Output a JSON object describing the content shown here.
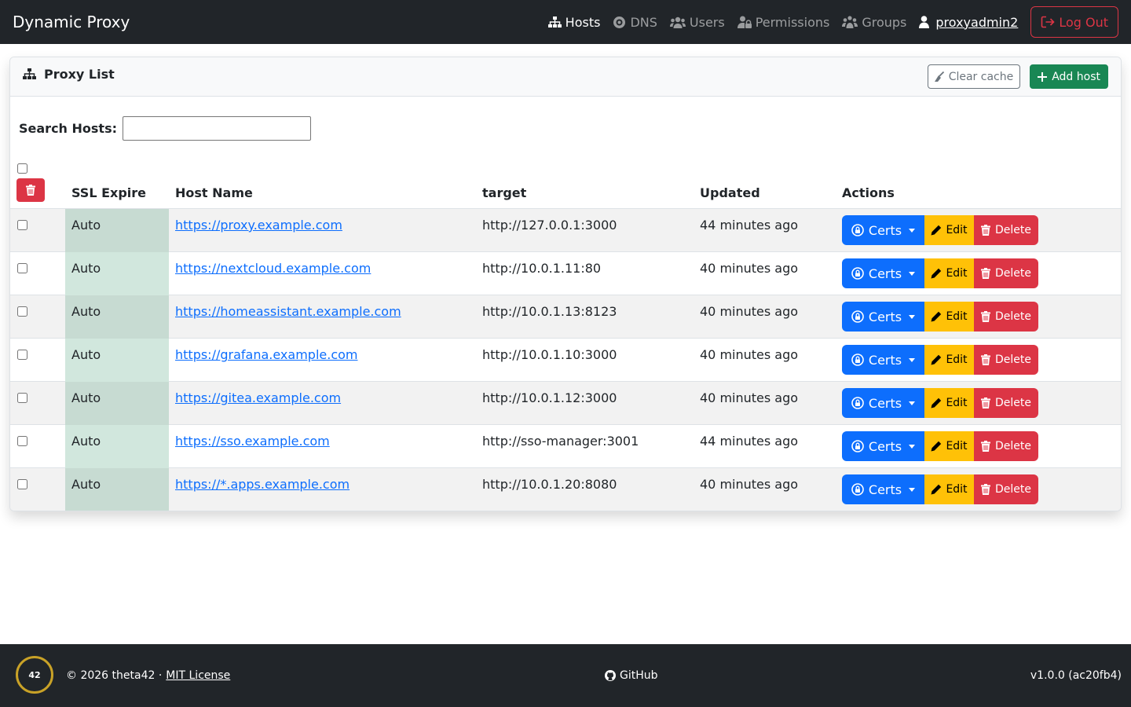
{
  "navbar": {
    "brand": "Dynamic Proxy",
    "links": [
      {
        "label": "Hosts",
        "icon": "sitemap-icon",
        "active": true
      },
      {
        "label": "DNS",
        "icon": "dns-icon",
        "active": false
      },
      {
        "label": "Users",
        "icon": "users-icon",
        "active": false
      },
      {
        "label": "Permissions",
        "icon": "user-lock-icon",
        "active": false
      },
      {
        "label": "Groups",
        "icon": "groups-icon",
        "active": false
      }
    ],
    "username": "proxyadmin2",
    "logout_label": "Log Out"
  },
  "card": {
    "title": "Proxy List",
    "clear_cache_label": "Clear cache",
    "add_host_label": "Add host"
  },
  "search": {
    "label": "Search Hosts:",
    "value": "",
    "placeholder": ""
  },
  "table": {
    "columns": [
      "SSL Expire",
      "Host Name",
      "target",
      "Updated",
      "Actions"
    ],
    "rows": [
      {
        "ssl": "Auto",
        "host": "https://proxy.example.com",
        "target": "http://127.0.0.1:3000",
        "updated": "44 minutes ago"
      },
      {
        "ssl": "Auto",
        "host": "https://nextcloud.example.com",
        "target": "http://10.0.1.11:80",
        "updated": "40 minutes ago"
      },
      {
        "ssl": "Auto",
        "host": "https://homeassistant.example.com",
        "target": "http://10.0.1.13:8123",
        "updated": "40 minutes ago"
      },
      {
        "ssl": "Auto",
        "host": "https://grafana.example.com",
        "target": "http://10.0.1.10:3000",
        "updated": "40 minutes ago"
      },
      {
        "ssl": "Auto",
        "host": "https://gitea.example.com",
        "target": "http://10.0.1.12:3000",
        "updated": "40 minutes ago"
      },
      {
        "ssl": "Auto",
        "host": "https://sso.example.com",
        "target": "http://sso-manager:3001",
        "updated": "44 minutes ago"
      },
      {
        "ssl": "Auto",
        "host": "https://*.apps.example.com",
        "target": "http://10.0.1.20:8080",
        "updated": "40 minutes ago"
      }
    ],
    "actions": {
      "certs": "Certs",
      "edit": "Edit",
      "delete": "Delete"
    }
  },
  "footer": {
    "logo_text": "42",
    "copyright": "© 2026 theta42 ·",
    "license": "MIT License",
    "github": "GitHub",
    "version": "v1.0.0 (ac20fb4)"
  },
  "colors": {
    "navbar_bg": "#212529",
    "primary": "#0d6efd",
    "success": "#198754",
    "warning": "#ffc107",
    "danger": "#dc3545",
    "ssl_cell": "#d1e7dd"
  }
}
